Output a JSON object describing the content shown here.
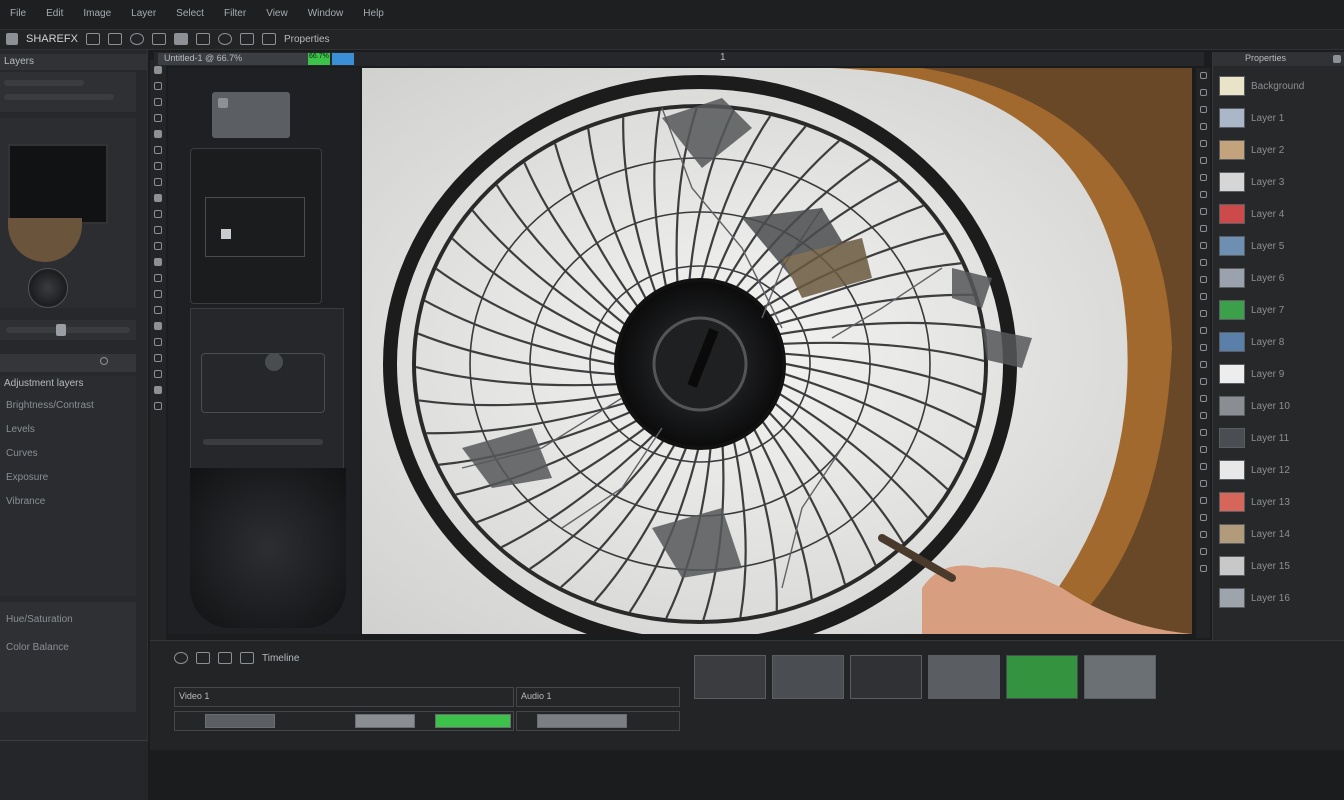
{
  "menubar": {
    "items": [
      "File",
      "Edit",
      "Image",
      "Layer",
      "Select",
      "Filter",
      "View",
      "Window",
      "Help"
    ]
  },
  "toolbar": {
    "workspace_label": "SHAREFX",
    "mode_label": "Properties"
  },
  "tab": {
    "label": "Untitled-1 @ 66.7%",
    "zoom": "66.7%",
    "page_indicator": "1"
  },
  "left_panel": {
    "tab_label": "Layers",
    "section_title": "Adjustment layers",
    "rows": [
      "Brightness/Contrast",
      "Levels",
      "Curves",
      "Exposure",
      "Vibrance",
      "Hue/Saturation",
      "Color Balance"
    ]
  },
  "right_panel": {
    "header": "Properties",
    "rows": [
      "Background",
      "Layer 1",
      "Layer 2",
      "Layer 3",
      "Layer 4",
      "Layer 5",
      "Layer 6",
      "Layer 7",
      "Layer 8",
      "Layer 9",
      "Layer 10",
      "Layer 11",
      "Layer 12",
      "Layer 13",
      "Layer 14",
      "Layer 15",
      "Layer 16"
    ]
  },
  "timeline": {
    "label": "Timeline",
    "track_a": "Video 1",
    "track_b": "Audio 1"
  },
  "colors": {
    "bg": "#1b1c1e",
    "panel": "#2a2c2f",
    "accent_green": "#3cc24a",
    "accent_blue": "#3a8fd6",
    "canvas_bg": "#e9e9e7",
    "wood": "#a2692e"
  }
}
